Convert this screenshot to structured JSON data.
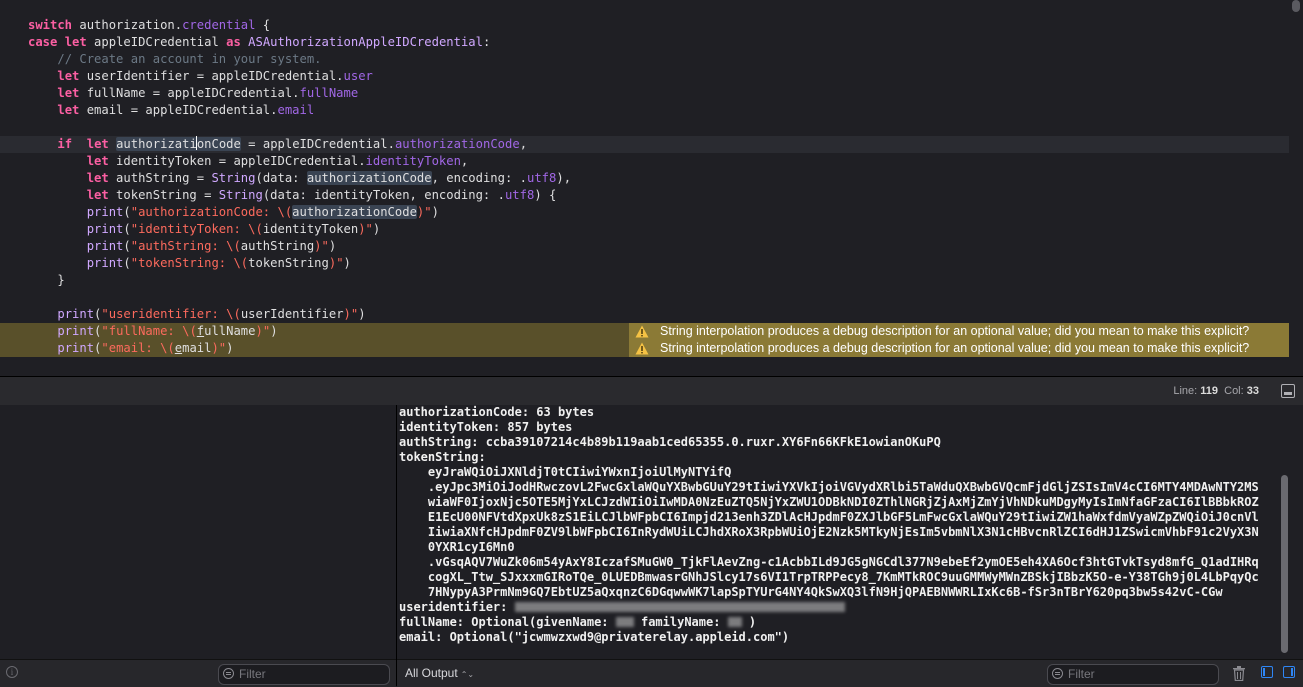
{
  "editor": {
    "warning_text": "String interpolation produces a debug description for an optional value; did you mean to make this explicit?"
  },
  "status": {
    "line_label": "Line:",
    "line_value": "119",
    "col_label": "Col:",
    "col_value": "33"
  },
  "console": {
    "lines": [
      "authorizationCode: 63 bytes",
      "identityToken: 857 bytes",
      "authString: ccba39107214c4b89b119aab1ced65355.0.ruxr.XY6Fn66KFkE1owianOKuPQ",
      "tokenString:",
      "    eyJraWQiOiJXNldjT0tCIiwiYWxnIjoiUlMyNTYifQ",
      "    .eyJpc3MiOiJodHRwczovL2FwcGxlaWQuYXBwbGUuY29tIiwiYXVkIjoiVGVydXRlbi5TaWduQXBwbGVQcmFjdGljZSIsImV4cCI6MTY4MDAwNTY2MS",
      "    wiaWF0IjoxNjc5OTE5MjYxLCJzdWIiOiIwMDA0NzEuZTQ5NjYxZWU1ODBkNDI0ZThlNGRjZjAxMjZmYjVhNDkuMDgyMyIsImNfaGFzaCI6IlBBbkROZ",
      "    E1EcU00NFVtdXpxUk8zS1EiLCJlbWFpbCI6Impjd213enh3ZDlAcHJpdmF0ZXJlbGF5LmFwcGxlaWQuY29tIiwiZW1haWxfdmVyaWZpZWQiOiJ0cnVl",
      "    IiwiaXNfcHJpdmF0ZV9lbWFpbCI6InRydWUiLCJhdXRoX3RpbWUiOjE2Nzk5MTkyNjEsIm5vbmNlX3N1cHBvcnRlZCI6dHJ1ZSwicmVhbF91c2VyX3N",
      "    0YXR1cyI6Mn0",
      "    .vGsqAQV7WuZk06m54yAxY8IczafSMuGW0_TjkFlAevZng-c1AcbbILd9JG5gNGCdl377N9ebeEf2ymOE5eh4XA6Ocf3htGTvkTsyd8mfG_Q1adIHRq",
      "    cogXL_Ttw_SJxxxmGIRoTQe_0LUEDBmwasrGNhJSlcy17s6VI1TrpTRPPecy8_7KmMTkROC9uuGMMWyMWnZBSkjIBbzK5O-e-Y38TGh9j0L4LbPqyQc",
      "    7HNypyA3PrmNm9GQ7EbtUZ5aQxqnzC6DGqwwWK7lapSpTYUrG4NY4QkSwXQ3lfN9HjQPAEBNWWRLIxKc6B-fSr3nTBrY620pq3bw5s42vC-CGw",
      "useridentifier: ",
      "fullName: Optional(givenName: ",
      "email: Optional(\"jcwmwzxwd9@privaterelay.appleid.com\")"
    ],
    "fullname_mid": " familyName: ",
    "fullname_end": " )"
  },
  "bottom_bar": {
    "filter_placeholder": "Filter",
    "output_selector": "All Output",
    "console_filter_placeholder": "Filter"
  }
}
